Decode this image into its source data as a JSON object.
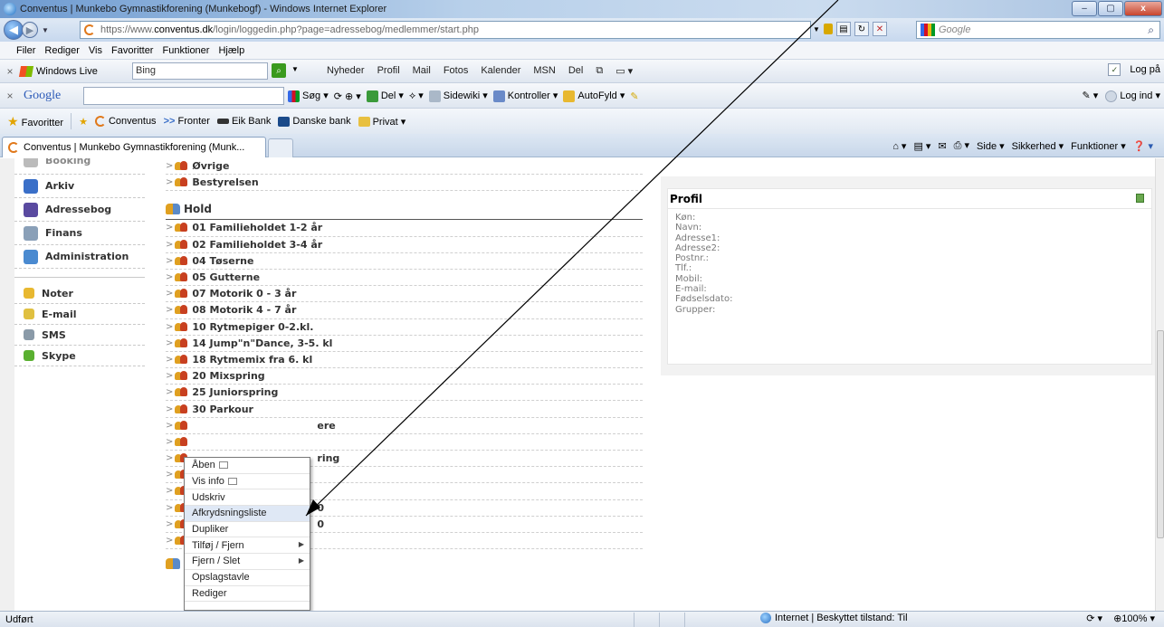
{
  "window": {
    "title": "Conventus | Munkebo Gymnastikforening (Munkebogf) - Windows Internet Explorer",
    "min": "–",
    "max": "▢",
    "close": "x"
  },
  "address": {
    "url_scheme": "https://www.",
    "url_domain": "conventus.dk",
    "url_path": "/login/loggedin.php?page=adressebog/medlemmer/start.php",
    "search_placeholder": "Google"
  },
  "menu": [
    "Filer",
    "Rediger",
    "Vis",
    "Favoritter",
    "Funktioner",
    "Hjælp"
  ],
  "windows_live": {
    "brand": "Windows Live",
    "search_value": "Bing",
    "links": [
      "Nyheder",
      "Profil",
      "Mail",
      "Fotos",
      "Kalender",
      "MSN",
      "Del"
    ],
    "login": "Log på"
  },
  "google_toolbar": {
    "brand": "Google",
    "search": "Søg",
    "share": "Del",
    "sidewiki": "Sidewiki",
    "spell": "Kontroller",
    "autofill": "AutoFyld",
    "login": "Log ind"
  },
  "favorites": {
    "label": "Favoritter",
    "items": [
      "Conventus",
      "Fronter",
      "Eik Bank",
      "Danske bank",
      "Privat"
    ]
  },
  "tab": {
    "label": "Conventus | Munkebo Gymnastikforening (Munk..."
  },
  "commandbar": {
    "page": "Side",
    "safety": "Sikkerhed",
    "tools": "Funktioner"
  },
  "sidebar": {
    "partial": "Booking",
    "main": [
      {
        "label": "Arkiv",
        "color": "#3a6fc8"
      },
      {
        "label": "Adressebog",
        "color": "#5a4aa0"
      },
      {
        "label": "Finans",
        "color": "#8aa0b8"
      },
      {
        "label": "Administration",
        "color": "#4a8ad0"
      }
    ],
    "extra": [
      {
        "label": "Noter",
        "color": "#e8b830"
      },
      {
        "label": "E-mail",
        "color": "#e0c040"
      },
      {
        "label": "SMS",
        "color": "#8a9aa8"
      },
      {
        "label": "Skype",
        "color": "#5ab030"
      }
    ]
  },
  "tree": {
    "top_groups": [
      "Øvrige",
      "Bestyrelsen"
    ],
    "hold_title": "Hold",
    "hold": [
      "01 Familieholdet 1-2 år",
      "02 Familieholdet 3-4 år",
      "04 Tøserne",
      "05 Gutterne",
      "07 Motorik 0 - 3 år",
      "08 Motorik 4 - 7 år",
      "10 Rytmepiger 0-2.kl.",
      "14 Jump\"n\"Dance, 3-5. kl",
      "18 Rytmemix fra 6. kl",
      "20 Mixspring",
      "25 Juniorspring",
      "30 Parkour"
    ],
    "obscured_fragments": [
      "ere",
      "",
      "ring",
      "",
      "",
      "0",
      "0",
      ""
    ]
  },
  "profile": {
    "title": "Profil",
    "fields": [
      "Køn:",
      "Navn:",
      "Adresse1:",
      "Adresse2:",
      "Postnr.:",
      "Tlf.:",
      "Mobil:",
      "E-mail:",
      "Fødselsdato:",
      "Grupper:"
    ]
  },
  "context_menu": {
    "items": [
      {
        "label": "Åben",
        "submenu": false,
        "highlight": false
      },
      {
        "label": "Vis info",
        "submenu": false,
        "highlight": false
      },
      {
        "label": "Udskriv",
        "submenu": false,
        "highlight": false
      },
      {
        "label": "Afkrydsningsliste",
        "submenu": false,
        "highlight": true
      },
      {
        "label": "Dupliker",
        "submenu": false,
        "highlight": false
      },
      {
        "label": "Tilføj / Fjern",
        "submenu": true,
        "highlight": false
      },
      {
        "label": "Fjern / Slet",
        "submenu": true,
        "highlight": false
      },
      {
        "label": "Opslagstavle",
        "submenu": false,
        "highlight": false
      },
      {
        "label": "Rediger",
        "submenu": false,
        "highlight": false
      }
    ]
  },
  "status": {
    "text": "Udført",
    "zone": "Internet | Beskyttet tilstand: Til",
    "zoom": "100%"
  }
}
